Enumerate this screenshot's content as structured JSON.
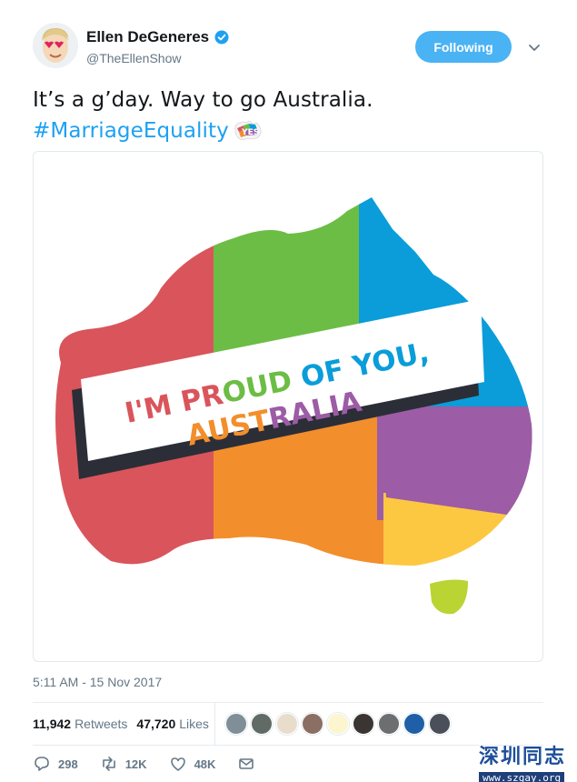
{
  "author": {
    "name": "Ellen DeGeneres",
    "handle": "@TheEllenShow",
    "verified": true,
    "avatar_icon": "avatar-heart-eyes"
  },
  "follow_button": {
    "label": "Following"
  },
  "menu": {
    "icon": "chevron-down-icon"
  },
  "tweet": {
    "line1": "It’s a g’day. Way to go Australia.",
    "hashtag": "#MarriageEquality",
    "hashflag_icon": "yes-hashflag-icon"
  },
  "media": {
    "banner_line1": "I'M PROUD OF YOU,",
    "banner_line2": "AUSTRALIA",
    "colors": {
      "red": "#d9555b",
      "green": "#6cbd45",
      "blue": "#0a9dd9",
      "orange": "#f28e2c",
      "purple": "#9c5ca6",
      "yellow": "#fdc841",
      "lime": "#b9d433",
      "dark": "#2b2e37"
    }
  },
  "timestamp": "5:11 AM - 15 Nov 2017",
  "stats": {
    "retweets_count": "11,942",
    "retweets_label": "Retweets",
    "likes_count": "47,720",
    "likes_label": "Likes"
  },
  "likers": [
    {
      "name": "liker-1",
      "color": "#7f8e97"
    },
    {
      "name": "liker-2",
      "color": "#5f6b64"
    },
    {
      "name": "liker-3",
      "color": "#e8dccb"
    },
    {
      "name": "liker-4",
      "color": "#8a6f62"
    },
    {
      "name": "liker-5",
      "color": "#fbf6cf"
    },
    {
      "name": "liker-6",
      "color": "#3a3532"
    },
    {
      "name": "liker-7",
      "color": "#6d6e70"
    },
    {
      "name": "liker-8",
      "color": "#1f5fa8"
    },
    {
      "name": "liker-9",
      "color": "#4b4f5a"
    }
  ],
  "actions": {
    "reply_count": "298",
    "retweet_count": "12K",
    "like_count": "48K"
  },
  "watermark": {
    "text_cn": "深圳同志",
    "url": "www.szgay.org"
  }
}
